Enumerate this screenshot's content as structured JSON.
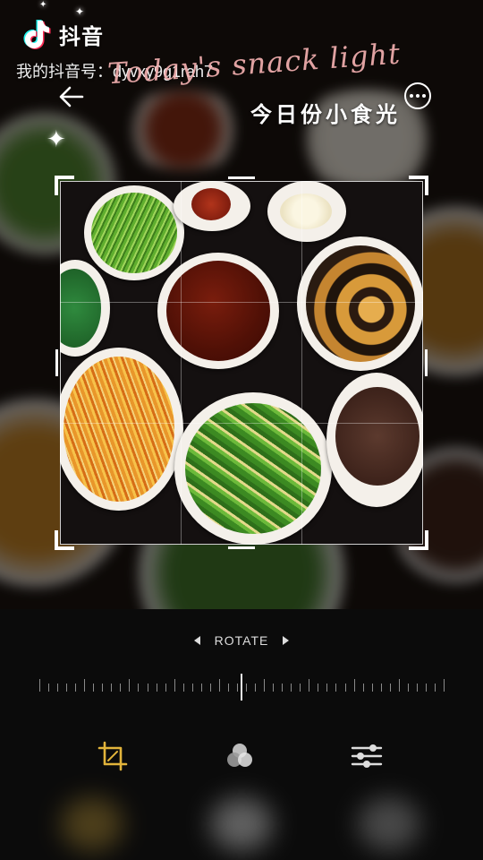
{
  "overlay": {
    "app_name": "抖音",
    "user_id_text": "我的抖音号：dyvxy9g1rah7",
    "script_title": "Today's snack light",
    "cn_title": "今日份小食光"
  },
  "editor": {
    "rotate_label": "ROTATE",
    "rotation_level": 0.5,
    "tools": [
      "crop-icon",
      "filters-icon",
      "adjust-icon"
    ],
    "active_tool": "crop-icon"
  },
  "colors": {
    "accent": "#e2b43b",
    "script_pink": "#f3b0b0",
    "toolbar_bg": "#0b0b0b"
  },
  "photo": {
    "dishes": [
      "cucumber salad",
      "chili sauce",
      "garlic cloves",
      "stewed pork",
      "spinach",
      "fried egg with fungus",
      "bean sprouts with carrot",
      "green beans with corn",
      "sesame dipping sauce"
    ]
  }
}
